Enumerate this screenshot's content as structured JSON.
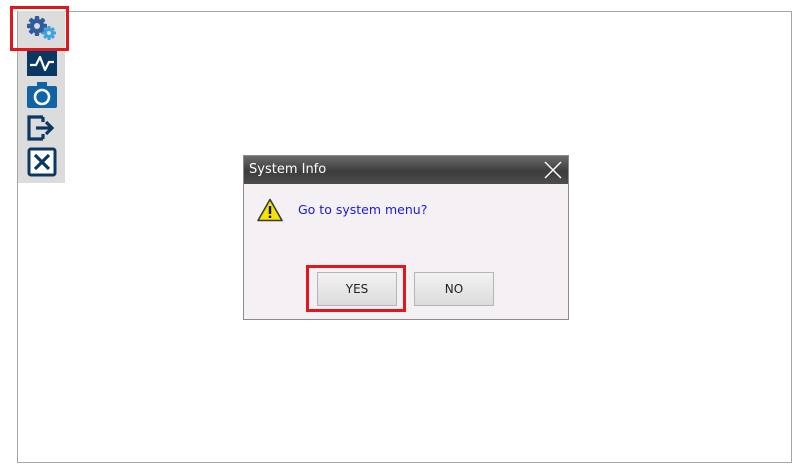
{
  "toolbar": {
    "items": [
      {
        "icon": "settings-gears-icon",
        "color": "#2d5d9a"
      },
      {
        "icon": "trend-chart-icon",
        "color": "#0b3763"
      },
      {
        "icon": "camera-icon",
        "color": "#1163a8"
      },
      {
        "icon": "logout-icon",
        "color": "#0b3763"
      },
      {
        "icon": "close-x-icon",
        "color": "#0b3763"
      }
    ]
  },
  "dialog": {
    "title": "System Info",
    "message": "Go to system menu?",
    "yes_label": "YES",
    "no_label": "NO",
    "message_color": "#1a1ad6"
  },
  "colors": {
    "highlight": "#e3161e",
    "titlebar": "#444444",
    "dialog_bg": "#f4f0f4",
    "toolbar_bg": "#dcdcdc"
  }
}
